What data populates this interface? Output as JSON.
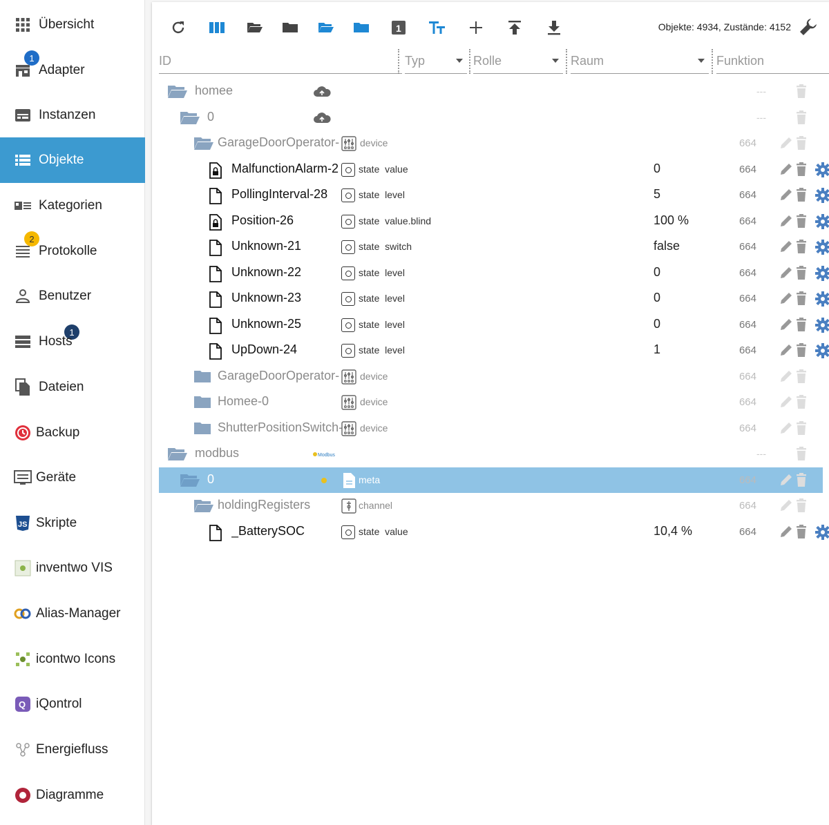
{
  "sidebar": {
    "items": [
      {
        "label": "Übersicht",
        "icon": "apps-grid-icon"
      },
      {
        "label": "Adapter",
        "icon": "store-icon",
        "badge": "1"
      },
      {
        "label": "Instanzen",
        "icon": "instances-icon"
      },
      {
        "label": "Objekte",
        "icon": "list-icon",
        "active": true
      },
      {
        "label": "Kategorien",
        "icon": "categories-icon"
      },
      {
        "label": "Protokolle",
        "icon": "log-icon",
        "badge": "2"
      },
      {
        "label": "Benutzer",
        "icon": "user-icon"
      },
      {
        "label": "Hosts",
        "icon": "hosts-icon",
        "badge": "1"
      },
      {
        "label": "Dateien",
        "icon": "files-icon"
      },
      {
        "label": "Backup",
        "icon": "backup-icon"
      },
      {
        "label": "Geräte",
        "icon": "devices-icon"
      },
      {
        "label": "Skripte",
        "icon": "javascript-icon"
      },
      {
        "label": "inventwo VIS",
        "icon": "inventwo-icon"
      },
      {
        "label": "Alias-Manager",
        "icon": "alias-icon"
      },
      {
        "label": "icontwo Icons",
        "icon": "icontwo-icon"
      },
      {
        "label": "iQontrol",
        "icon": "iqontrol-icon"
      },
      {
        "label": "Energiefluss",
        "icon": "energy-icon"
      },
      {
        "label": "Diagramme",
        "icon": "diagram-icon"
      }
    ]
  },
  "toolbar": {
    "stats": "Objekte: 4934, Zustände: 4152"
  },
  "filters": {
    "id": "ID",
    "typ": "Typ",
    "rolle": "Rolle",
    "raum": "Raum",
    "funktion": "Funktion"
  },
  "tree": [
    {
      "name": "homee",
      "level": 0,
      "kind": "folder-open",
      "logo": "cloud",
      "rolle": "",
      "value": "",
      "acl": "---"
    },
    {
      "name": "0",
      "level": 1,
      "kind": "folder-open",
      "logo": "cloud",
      "rolle": "",
      "value": "",
      "acl": "---"
    },
    {
      "name": "GarageDoorOperator-",
      "level": 2,
      "kind": "folder-open",
      "type": "device",
      "rolle": "device",
      "value": "",
      "acl": "664"
    },
    {
      "name": "MalfunctionAlarm-2",
      "level": 3,
      "kind": "file-lock",
      "type": "state",
      "rolle": "state  value",
      "value": "0",
      "acl": "664"
    },
    {
      "name": "PollingInterval-28",
      "level": 3,
      "kind": "file",
      "type": "state",
      "rolle": "state  level",
      "value": "5",
      "acl": "664"
    },
    {
      "name": "Position-26",
      "level": 3,
      "kind": "file-lock",
      "type": "state",
      "rolle": "state  value.blind",
      "value": "100 %",
      "acl": "664"
    },
    {
      "name": "Unknown-21",
      "level": 3,
      "kind": "file",
      "type": "state",
      "rolle": "state  switch",
      "value": "false",
      "acl": "664"
    },
    {
      "name": "Unknown-22",
      "level": 3,
      "kind": "file",
      "type": "state",
      "rolle": "state  level",
      "value": "0",
      "acl": "664"
    },
    {
      "name": "Unknown-23",
      "level": 3,
      "kind": "file",
      "type": "state",
      "rolle": "state  level",
      "value": "0",
      "acl": "664"
    },
    {
      "name": "Unknown-25",
      "level": 3,
      "kind": "file",
      "type": "state",
      "rolle": "state  level",
      "value": "0",
      "acl": "664"
    },
    {
      "name": "UpDown-24",
      "level": 3,
      "kind": "file",
      "type": "state",
      "rolle": "state  level",
      "value": "1",
      "acl": "664"
    },
    {
      "name": "GarageDoorOperator-",
      "level": 2,
      "kind": "folder",
      "type": "device",
      "rolle": "device",
      "value": "",
      "acl": "664"
    },
    {
      "name": "Homee-0",
      "level": 2,
      "kind": "folder",
      "type": "device",
      "rolle": "device",
      "value": "",
      "acl": "664"
    },
    {
      "name": "ShutterPositionSwitch-",
      "level": 2,
      "kind": "folder",
      "type": "device",
      "rolle": "device",
      "value": "",
      "acl": "664"
    },
    {
      "name": "modbus",
      "level": 0,
      "kind": "folder-open",
      "logo": "modbus",
      "rolle": "",
      "value": "",
      "acl": "---"
    },
    {
      "name": "0",
      "level": 1,
      "kind": "folder-open",
      "logo": "modbus-small",
      "type": "meta",
      "rolle": "meta",
      "value": "",
      "acl": "664",
      "selected": true
    },
    {
      "name": "holdingRegisters",
      "level": 2,
      "kind": "folder-open",
      "type": "channel",
      "rolle": "channel",
      "value": "",
      "acl": "664"
    },
    {
      "name": "_BatterySOC",
      "level": 3,
      "kind": "file",
      "type": "state",
      "rolle": "state  value",
      "value": "10,4 %",
      "acl": "664"
    }
  ],
  "logos": {
    "modbus": "Modbus"
  },
  "colors": {
    "accent": "#3c9ad0",
    "selected_row": "#8fc3e5",
    "toolbar_icon_blue": "#1e88d4",
    "folder": "#8aa4c0",
    "gear": "#4a7fc1"
  }
}
